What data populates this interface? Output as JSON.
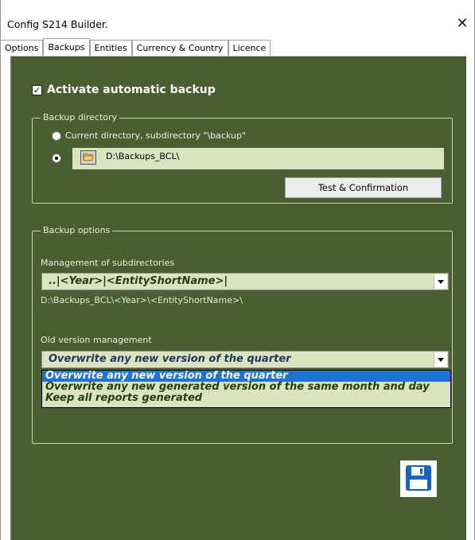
{
  "window": {
    "title": "Config S214 Builder.",
    "close_glyph": "✕"
  },
  "tabs": [
    {
      "label": "Options",
      "active": false
    },
    {
      "label": "Backups",
      "active": true
    },
    {
      "label": "Entities",
      "active": false
    },
    {
      "label": "Currency & Country",
      "active": false
    },
    {
      "label": "Licence",
      "active": false
    }
  ],
  "backups": {
    "activate_label": "Activate automatic backup",
    "activate_checked": true,
    "directory_group": {
      "legend": "Backup directory",
      "radio_current_label": "Current directory, subdirectory \"\\backup\"",
      "radio_custom_selected": true,
      "path_value": "D:\\Backups_BCL\\",
      "folder_icon": "folder-open-icon",
      "test_button": "Test & Confirmation"
    },
    "options_group": {
      "legend": "Backup options",
      "subdir_label": "Management of subdirectories",
      "subdir_value": "..|<Year>|<EntityShortName>|",
      "subdir_preview": "D:\\Backups_BCL\\<Year>\\<EntityShortName>\\",
      "oldver_label": "Old version management",
      "oldver_value": "Overwrite any new version of the quarter",
      "oldver_options": [
        "Overwrite any new version of the quarter",
        "Overwrite any new generated version of the same month and day",
        "Keep all reports generated"
      ],
      "oldver_selected_index": 0
    },
    "save_icon": "floppy-disk-icon"
  },
  "colors": {
    "panel_bg": "#4a5f31",
    "field_bg": "#d8e4bf",
    "selection": "#1e73d8",
    "save_icon": "#1565c0"
  }
}
